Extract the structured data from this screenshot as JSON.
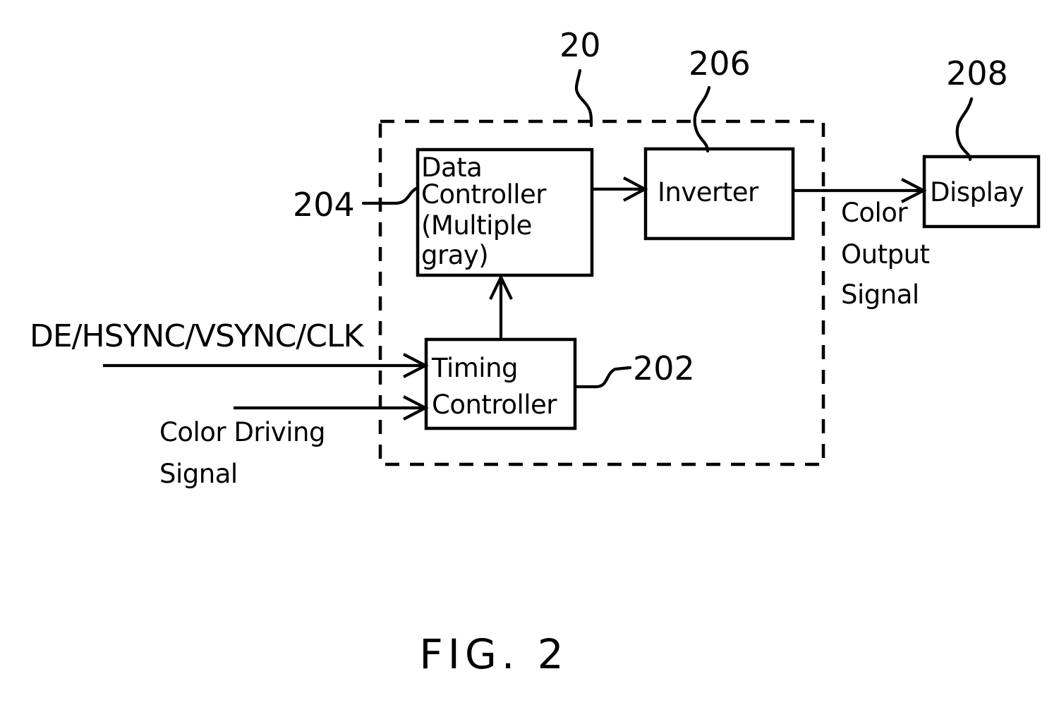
{
  "figure": {
    "caption": "FIG. 2",
    "enclosure_ref": "20"
  },
  "blocks": [
    {
      "id": "data-controller",
      "lines": [
        "Data",
        "Controller",
        "(Multiple",
        " gray)"
      ],
      "ref": "204"
    },
    {
      "id": "inverter",
      "lines": [
        "Inverter"
      ],
      "ref": "206"
    },
    {
      "id": "display",
      "lines": [
        "Display"
      ],
      "ref": "208"
    },
    {
      "id": "timing-controller",
      "lines": [
        "Timing",
        "Controller"
      ],
      "ref": "202"
    }
  ],
  "labels": {
    "input_sync": "DE/HSYNC/VSYNC/CLK",
    "input_color_driving_line1": "Color Driving",
    "input_color_driving_line2": "Signal",
    "output_line1": "Color",
    "output_line2": "Output",
    "output_line3": "Signal"
  },
  "refs": {
    "enclosure": "20",
    "timing_controller": "202",
    "data_controller": "204",
    "inverter": "206",
    "display": "208"
  },
  "colors": {
    "ink": "#000000",
    "paper": "#ffffff"
  }
}
